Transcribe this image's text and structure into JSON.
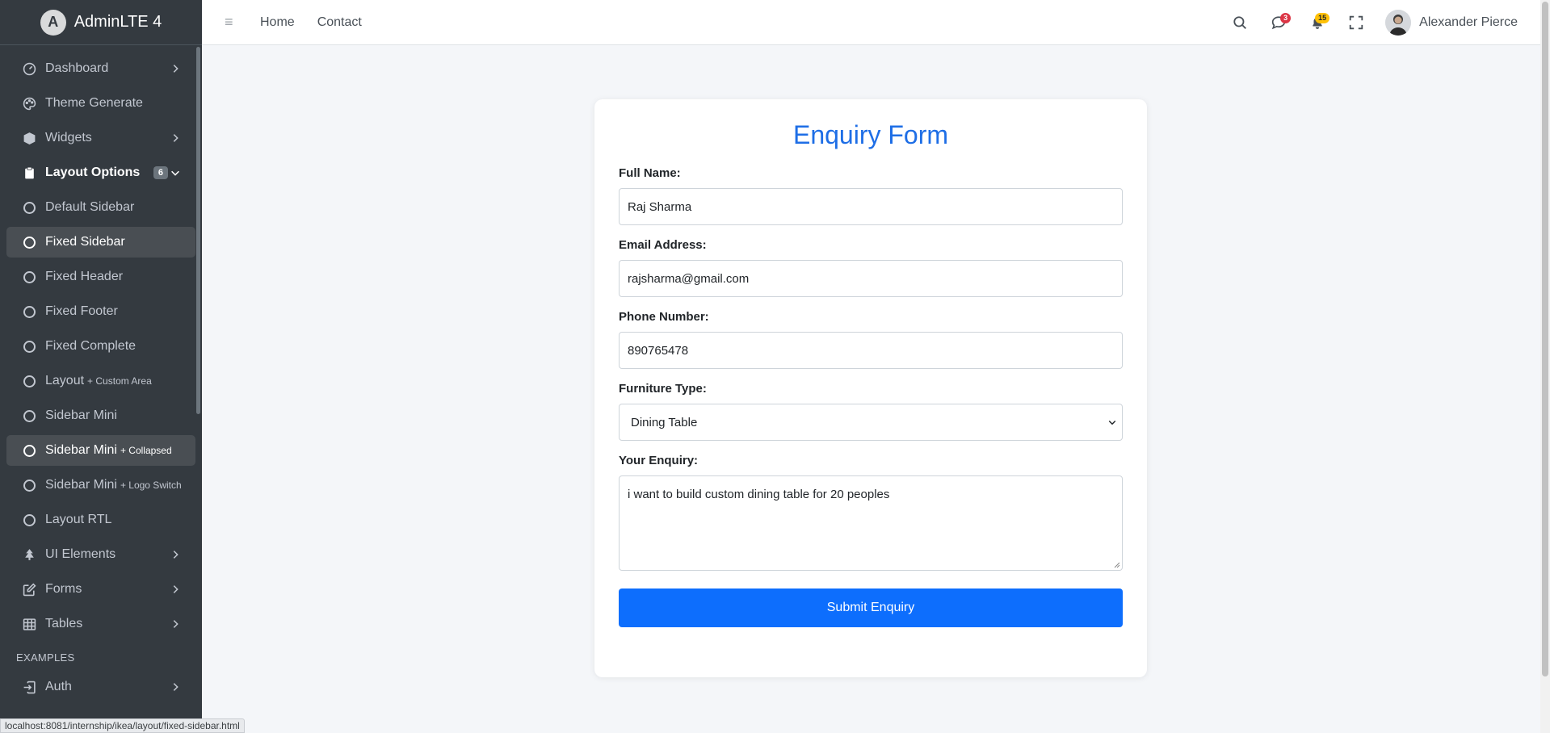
{
  "brand": {
    "name": "AdminLTE 4",
    "logo_letter": "A"
  },
  "sidebar": {
    "items": [
      {
        "label": "Dashboard",
        "icon": "speedometer-icon",
        "chevron": true
      },
      {
        "label": "Theme Generate",
        "icon": "palette-icon"
      },
      {
        "label": "Widgets",
        "icon": "box-icon",
        "chevron": true
      },
      {
        "label": "Layout Options",
        "icon": "clipboard-icon",
        "badge": "6",
        "expanded": true
      },
      {
        "label": "Default Sidebar"
      },
      {
        "label": "Fixed Sidebar",
        "active": true
      },
      {
        "label": "Fixed Header"
      },
      {
        "label": "Fixed Footer"
      },
      {
        "label": "Fixed Complete"
      },
      {
        "label": "Layout",
        "small": "+ Custom Area"
      },
      {
        "label": "Sidebar Mini"
      },
      {
        "label": "Sidebar Mini",
        "small": "+ Collapsed"
      },
      {
        "label": "Sidebar Mini",
        "small": "+ Logo Switch"
      },
      {
        "label": "Layout RTL"
      },
      {
        "label": "UI Elements",
        "icon": "tree-icon",
        "chevron": true
      },
      {
        "label": "Forms",
        "icon": "pencil-square-icon",
        "chevron": true
      },
      {
        "label": "Tables",
        "icon": "table-icon",
        "chevron": true
      }
    ],
    "section_header": "EXAMPLES",
    "auth": {
      "label": "Auth",
      "icon": "box-arrow-in-right-icon"
    }
  },
  "topbar": {
    "links": [
      "Home",
      "Contact"
    ],
    "messages_count": "3",
    "notifications_count": "15",
    "user_name": "Alexander Pierce"
  },
  "form": {
    "title": "Enquiry Form",
    "full_name_label": "Full Name:",
    "full_name_value": "Raj Sharma",
    "email_label": "Email Address:",
    "email_value": "rajsharma@gmail.com",
    "phone_label": "Phone Number:",
    "phone_value": "890765478",
    "furniture_label": "Furniture Type:",
    "furniture_value": "Dining Table",
    "enquiry_label": "Your Enquiry:",
    "enquiry_value": "i want to build custom dining table for 20 peoples",
    "submit_label": "Submit Enquiry"
  },
  "status_url": "localhost:8081/internship/ikea/layout/fixed-sidebar.html",
  "colors": {
    "sidebar_bg": "#343a40",
    "accent": "#0d6efd",
    "title": "#1e6ee6"
  }
}
